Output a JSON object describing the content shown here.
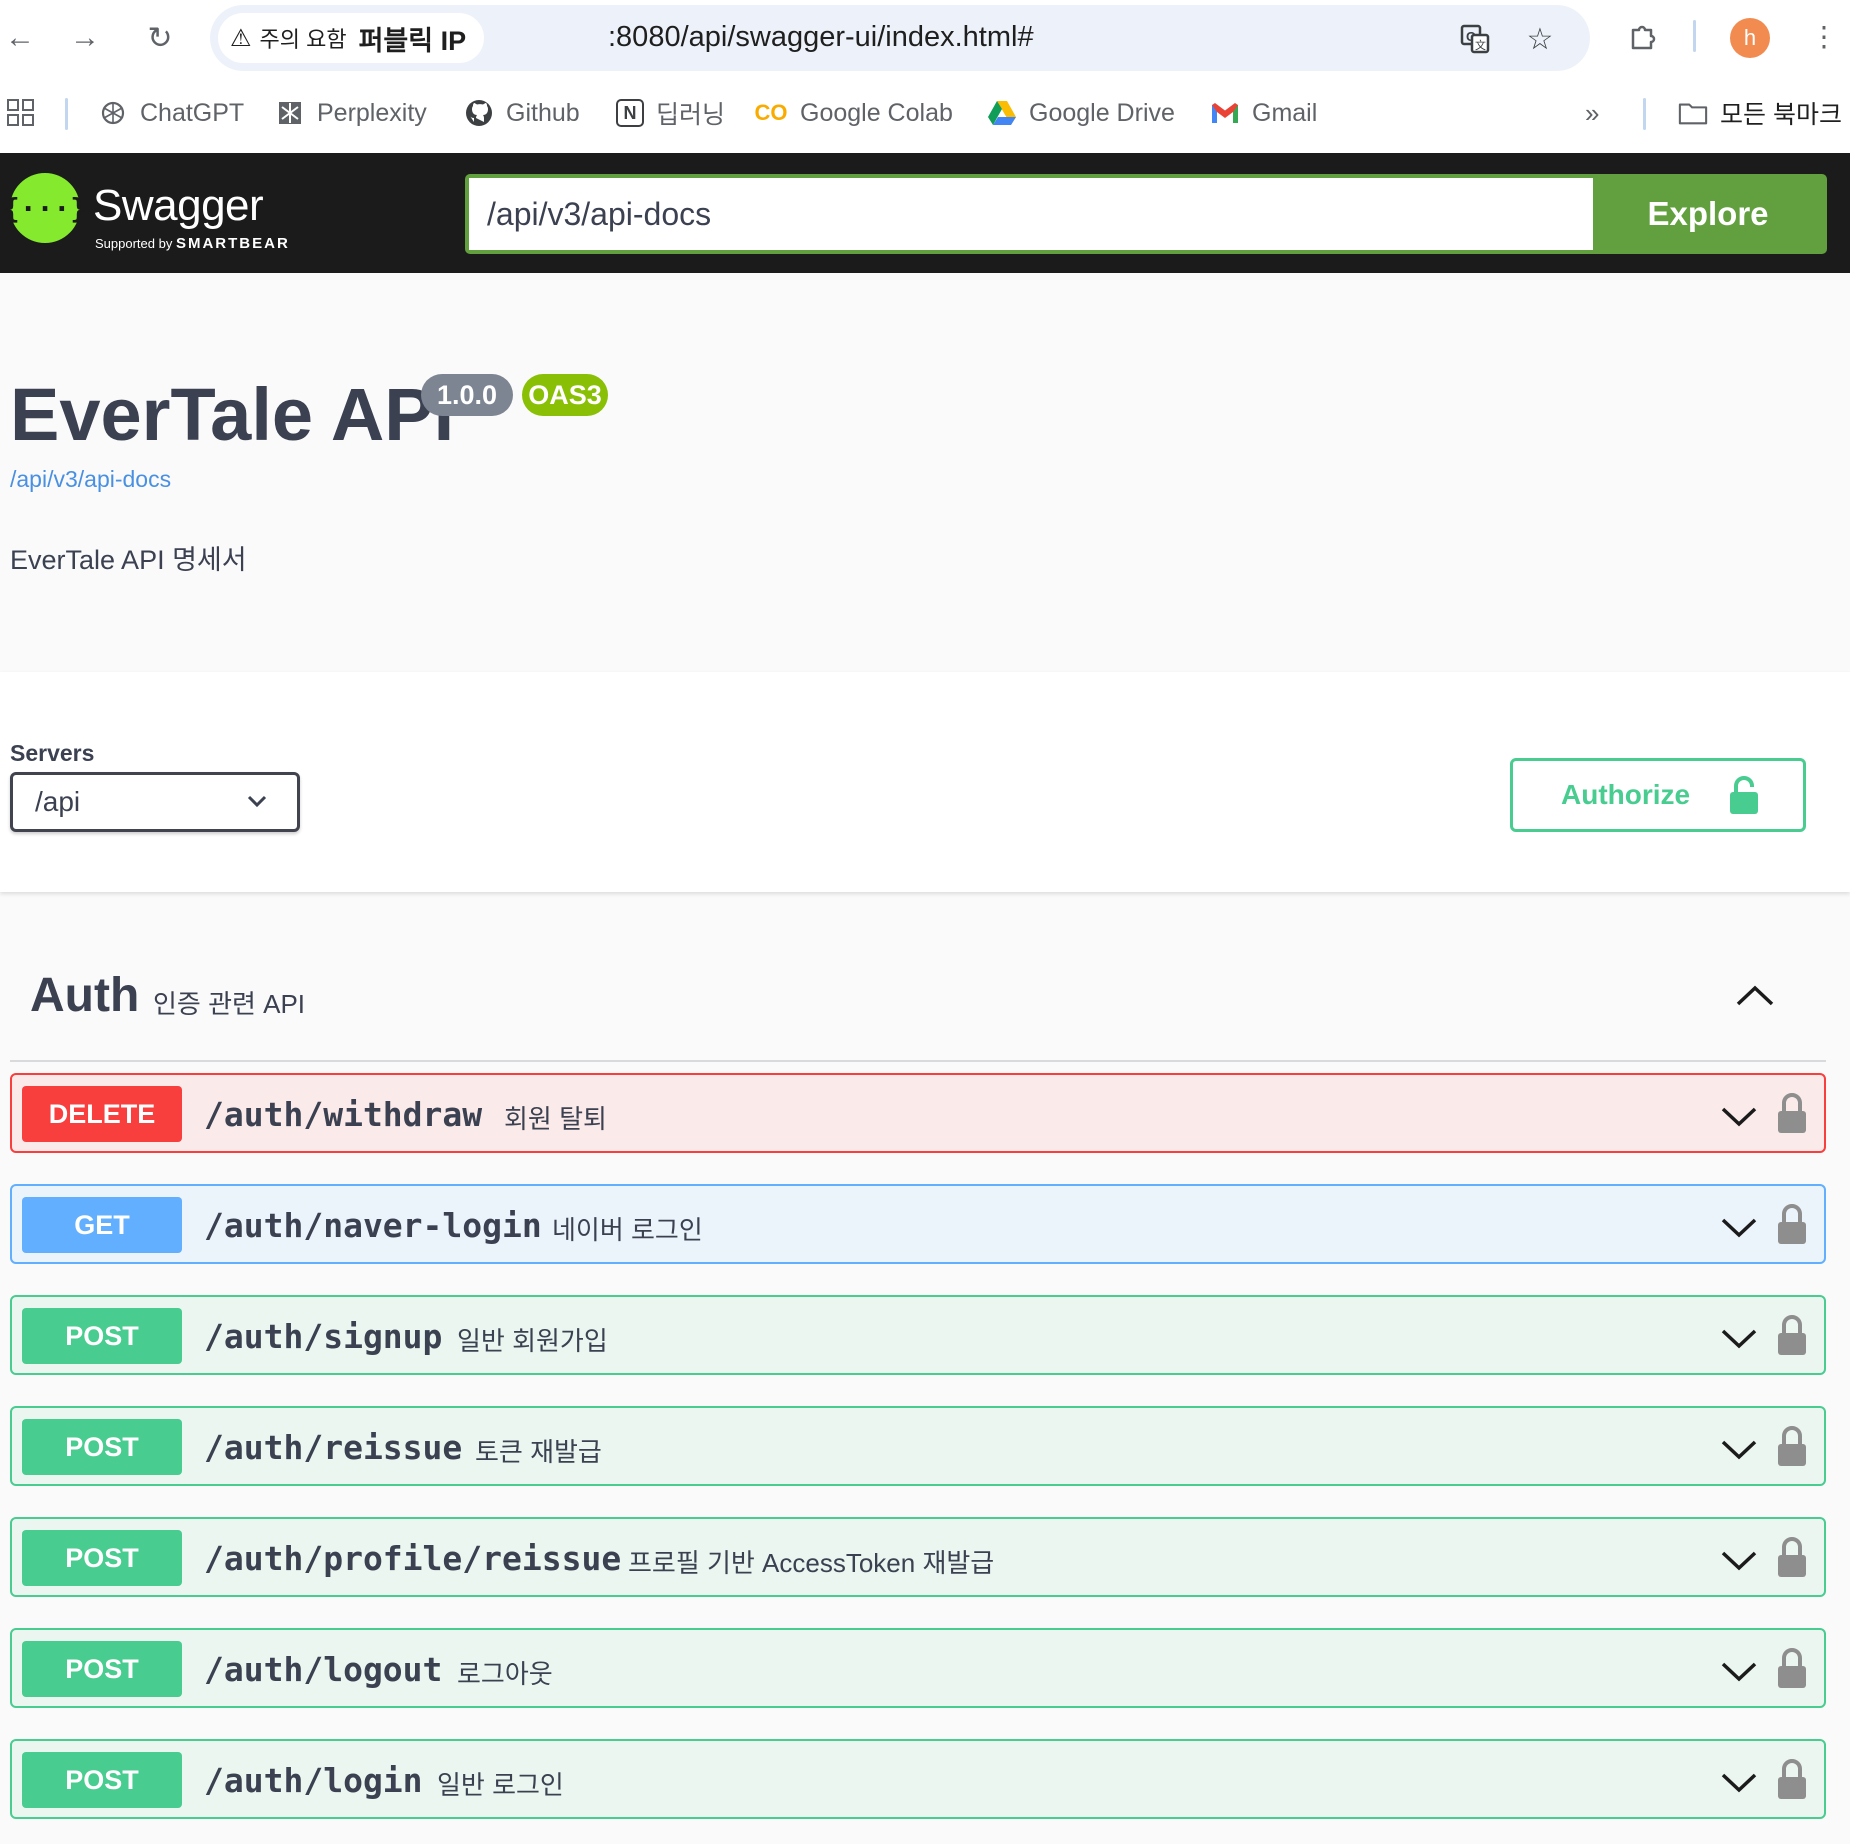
{
  "browser": {
    "security_label": "주의 요함",
    "security_host": "퍼블릭 IP",
    "url": ":8080/api/swagger-ui/index.html#",
    "avatar_letter": "h",
    "bookmarks": [
      {
        "label": "ChatGPT",
        "icon": "chatgpt-icon"
      },
      {
        "label": "Perplexity",
        "icon": "perplexity-icon"
      },
      {
        "label": "Github",
        "icon": "github-icon"
      },
      {
        "label": "딥러닝",
        "icon": "notion-icon"
      },
      {
        "label": "Google Colab",
        "icon": "colab-icon"
      },
      {
        "label": "Google Drive",
        "icon": "google-drive-icon"
      },
      {
        "label": "Gmail",
        "icon": "gmail-icon"
      }
    ],
    "all_bookmarks_label": "모든 북마크"
  },
  "topbar": {
    "logo_text": "Swagger",
    "logo_supported_by": "Supported by",
    "logo_company": "SMARTBEAR",
    "explore_value": "/api/v3/api-docs",
    "explore_label": "Explore"
  },
  "info": {
    "title": "EverTale API",
    "version": "1.0.0",
    "oas": "OAS3",
    "spec_link": "/api/v3/api-docs",
    "description": "EverTale API 명세서"
  },
  "servers": {
    "label": "Servers",
    "selected": "/api"
  },
  "authorize_label": "Authorize",
  "tag": {
    "name": "Auth",
    "description": "인증 관련 API",
    "expanded": true
  },
  "operations": [
    {
      "method": "DELETE",
      "path": "/auth/withdraw",
      "summary": "회원 탈퇴"
    },
    {
      "method": "GET",
      "path": "/auth/naver-login",
      "summary": "네이버 로그인"
    },
    {
      "method": "POST",
      "path": "/auth/signup",
      "summary": "일반 회원가입"
    },
    {
      "method": "POST",
      "path": "/auth/reissue",
      "summary": "토큰 재발급"
    },
    {
      "method": "POST",
      "path": "/auth/profile/reissue",
      "summary": "프로필 기반 AccessToken 재발급"
    },
    {
      "method": "POST",
      "path": "/auth/logout",
      "summary": "로그아웃"
    },
    {
      "method": "POST",
      "path": "/auth/login",
      "summary": "일반 로그인"
    }
  ],
  "colors": {
    "delete": "#f93e3e",
    "get": "#61affe",
    "post": "#49cc90",
    "explore": "#62a03f",
    "swagger_green": "#85ea2d",
    "topbar": "#1b1b1b"
  }
}
